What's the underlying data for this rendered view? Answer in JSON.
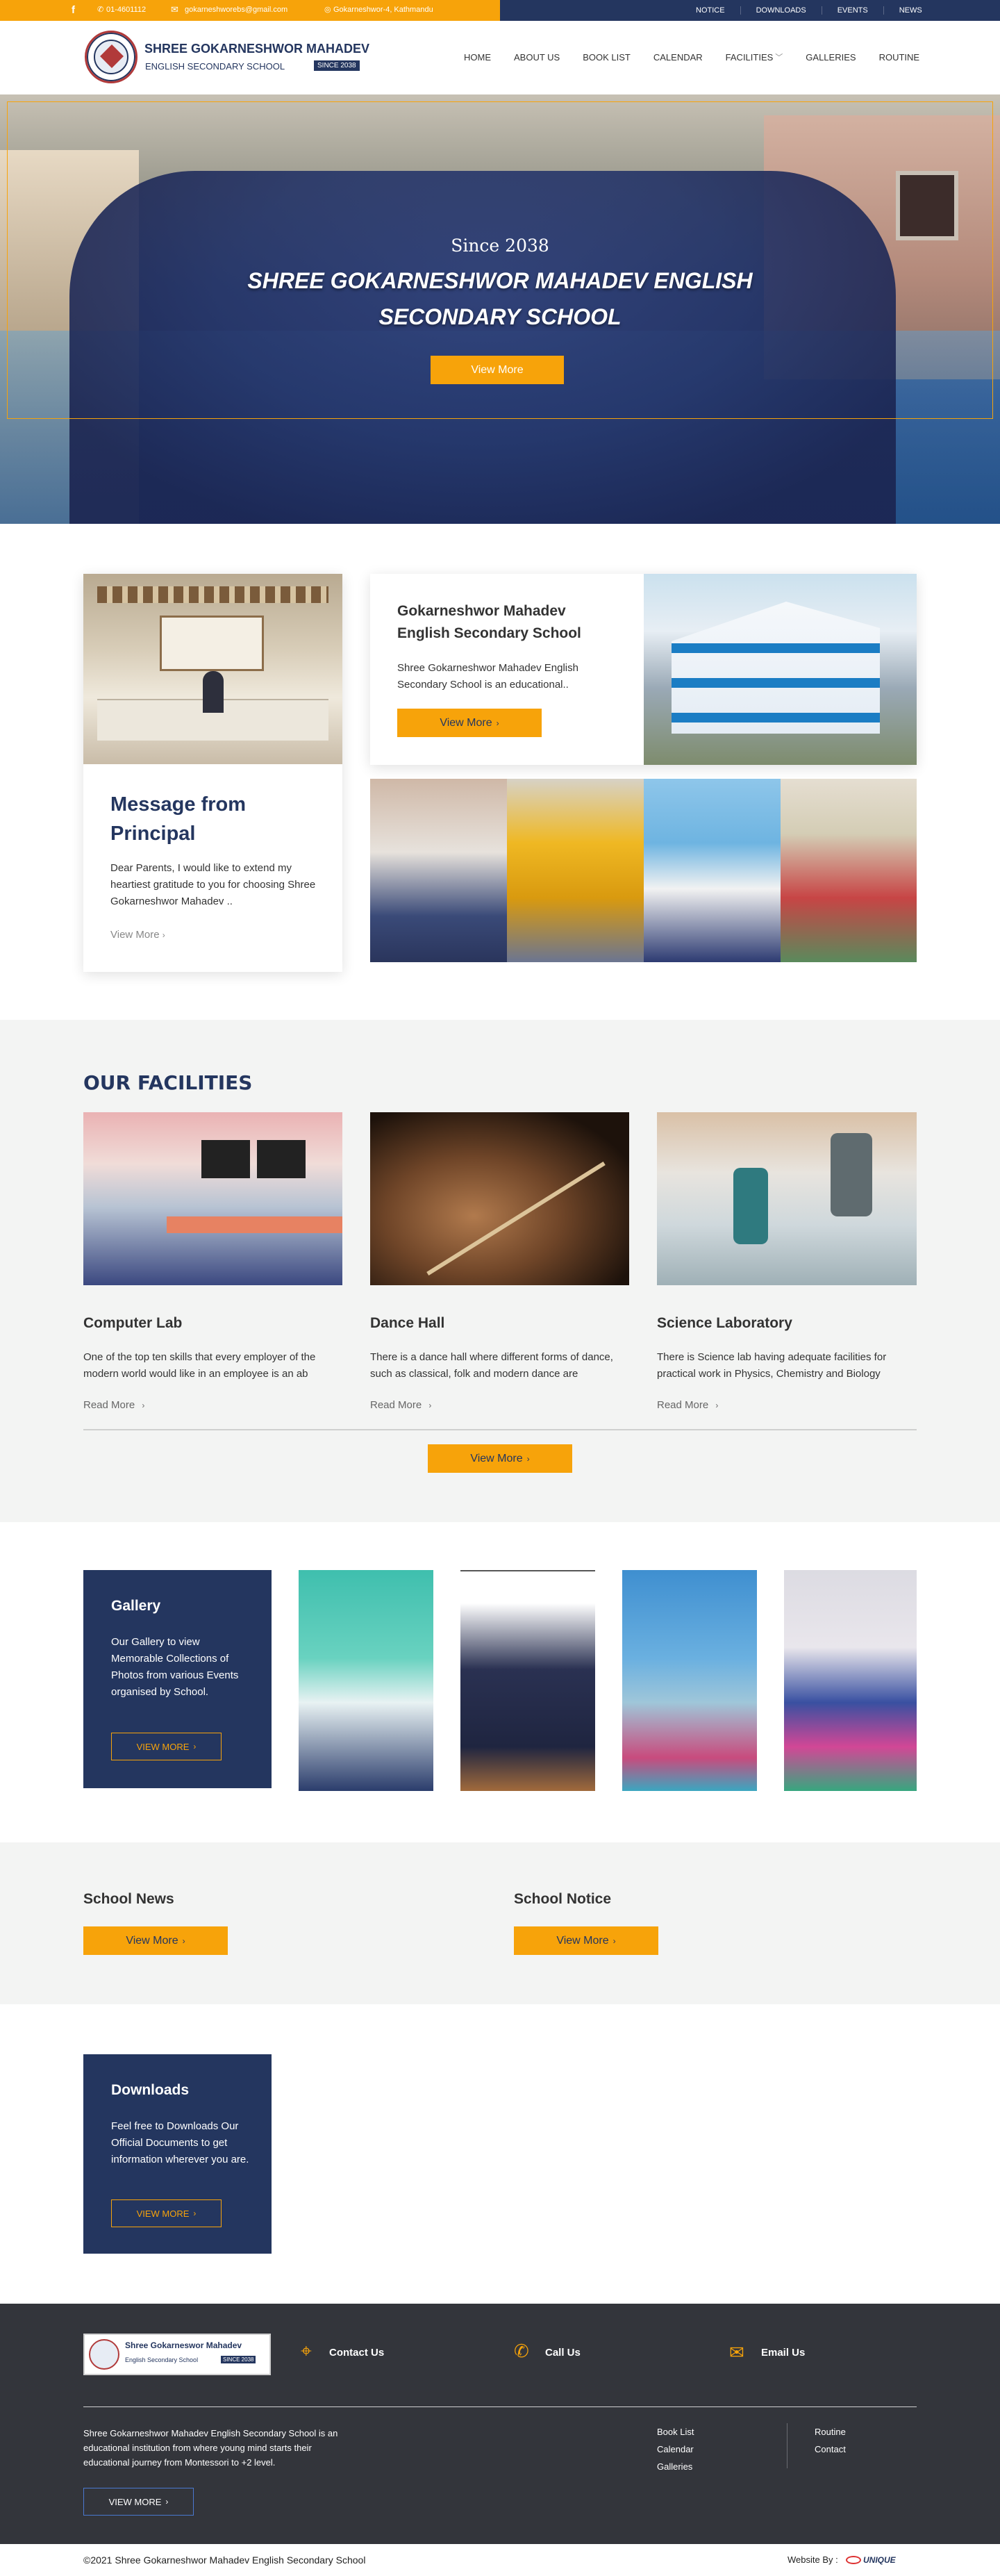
{
  "topbar": {
    "phone": "01-4601112",
    "email": "gokarneshworebs@gmail.com",
    "address": "Gokarneshwor-4, Kathmandu",
    "links": [
      "NOTICE",
      "DOWNLOADS",
      "EVENTS",
      "NEWS"
    ]
  },
  "header": {
    "school_name": "SHREE GOKARNESHWOR MAHADEV",
    "school_sub": "ENGLISH SECONDARY SCHOOL",
    "since_badge": "SINCE 2038",
    "nav": [
      "HOME",
      "ABOUT US",
      "BOOK LIST",
      "CALENDAR",
      "FACILITIES",
      "GALLERIES",
      "ROUTINE"
    ]
  },
  "hero": {
    "since": "Since 2038",
    "title_line1": "SHREE GOKARNESHWOR MAHADEV ENGLISH",
    "title_line2": "SECONDARY SCHOOL",
    "button": "View More"
  },
  "principal": {
    "title_line1": "Message from",
    "title_line2": "Principal",
    "text": "Dear Parents, I would like to extend my heartiest gratitude to you for choosing Shree Gokarneshwor Mahadev ..",
    "link": "View More"
  },
  "about": {
    "title_line1": "Gokarneshwor Mahadev",
    "title_line2": "English Secondary School",
    "text": "Shree Gokarneshwor Mahadev English Secondary School is an educational..",
    "button": "View More"
  },
  "facilities": {
    "heading": "OUR FACILITIES",
    "items": [
      {
        "title": "Computer Lab",
        "text": "One of the top ten skills that every employer of the modern world would like in an employee is an ab",
        "link": "Read More"
      },
      {
        "title": "Dance Hall",
        "text": "There is a  dance hall where different forms of dance, such as classical, folk and modern dance are",
        "link": "Read More"
      },
      {
        "title": "Science Laboratory",
        "text": "There is Science lab having adequate facilities for practical work in Physics, Chemistry and Biology",
        "link": "Read More"
      }
    ],
    "button": "View More"
  },
  "gallery": {
    "title": "Gallery",
    "text": "Our Gallery to view Memorable Collections of Photos from various Events organised by School.",
    "button": "VIEW MORE"
  },
  "news": {
    "title": "School News",
    "button": "View More"
  },
  "notice": {
    "title": "School Notice",
    "button": "View More"
  },
  "downloads": {
    "title": "Downloads",
    "text": "Feel free to Downloads Our Official Documents to get information wherever you are.",
    "button": "VIEW MORE"
  },
  "footer": {
    "logo_name": "Shree Gokarneswor Mahadev",
    "logo_sub": "English Secondary School",
    "logo_badge": "SINCE 2038",
    "contact": "Contact Us",
    "call": "Call Us",
    "email": "Email Us",
    "about_text": "Shree Gokarneshwor Mahadev English Secondary School is an educational institution from where young mind starts their educational journey from Montessori to +2 level.",
    "button": "VIEW MORE",
    "links_col1": [
      "Book List",
      "Calendar",
      "Galleries"
    ],
    "links_col2": [
      "Routine",
      "Contact"
    ],
    "copyright": "©2021 Shree Gokarneshwor Mahadev English Secondary School",
    "website_by": "Website By :",
    "vendor": "UNIQUE"
  },
  "colors": {
    "navy": "#24365f",
    "orange": "#f7a30a",
    "footer": "#33353b"
  }
}
